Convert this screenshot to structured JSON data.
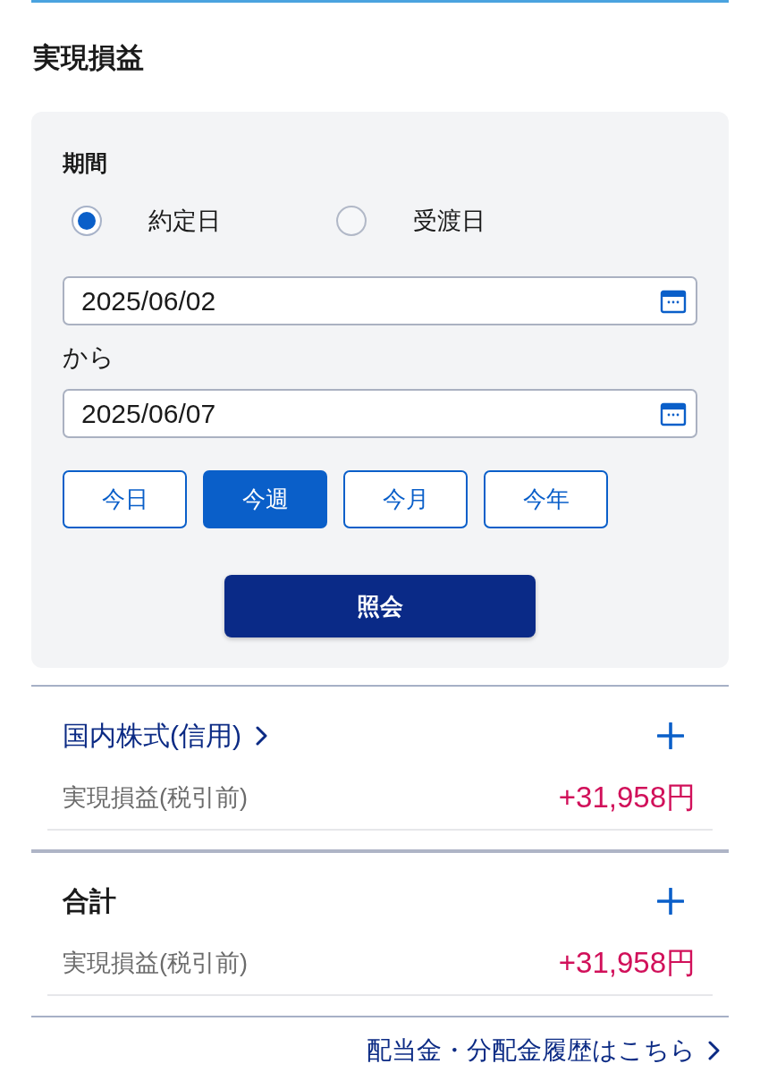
{
  "title": "実現損益",
  "filter": {
    "period_label": "期間",
    "date_basis": [
      {
        "label": "約定日",
        "selected": true
      },
      {
        "label": "受渡日",
        "selected": false
      }
    ],
    "start_date": {
      "value": "2025/06/02"
    },
    "range_word": "から",
    "end_date": {
      "value": "2025/06/07"
    },
    "presets": [
      {
        "label": "今日",
        "selected": false
      },
      {
        "label": "今週",
        "selected": true
      },
      {
        "label": "今月",
        "selected": false
      },
      {
        "label": "今年",
        "selected": false
      }
    ],
    "submit_button": "照会"
  },
  "sections": [
    {
      "kind": "category",
      "title": "国内株式(信用)",
      "expanded": false,
      "rows": [
        {
          "label": "実現損益(税引前)",
          "value": "+31,958円"
        }
      ]
    },
    {
      "kind": "total",
      "title": "合計",
      "expanded": false,
      "rows": [
        {
          "label": "実現損益(税引前)",
          "value": "+31,958円"
        }
      ]
    }
  ],
  "footer_link": "配当金・分配金履歴はこちら"
}
